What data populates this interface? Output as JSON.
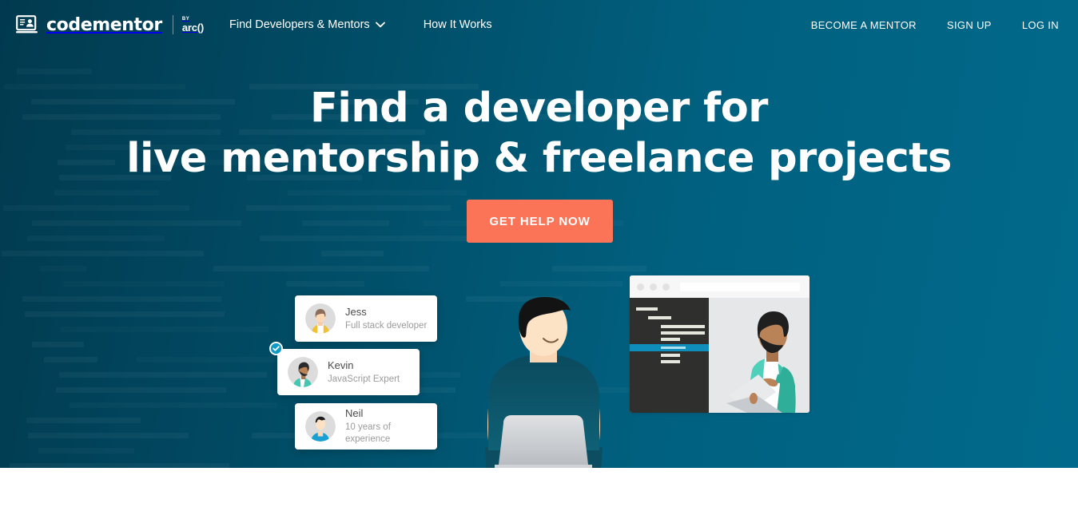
{
  "brand": {
    "name": "codementor",
    "by_label": "BY",
    "sub_name": "arc()",
    "logo_icon": "laptop-profile-icon",
    "accent_color": "#fc7458",
    "hero_gradient_from": "#013a4f",
    "hero_gradient_to": "#016a8c"
  },
  "nav": {
    "left_items": [
      {
        "label": "Find Developers & Mentors",
        "has_caret": true,
        "caret_icon": "chevron-down-icon"
      },
      {
        "label": "How It Works",
        "has_caret": false
      }
    ],
    "right_items": [
      {
        "label": "BECOME A MENTOR"
      },
      {
        "label": "SIGN UP"
      },
      {
        "label": "LOG IN"
      }
    ]
  },
  "hero": {
    "headline_line1": "Find a developer for",
    "headline_line2": "live mentorship & freelance projects",
    "cta_label": "GET HELP NOW"
  },
  "mentor_cards": [
    {
      "name": "Jess",
      "role": "Full stack developer",
      "avatar_icon": "avatar-jess",
      "verified": false
    },
    {
      "name": "Kevin",
      "role": "JavaScript Expert",
      "avatar_icon": "avatar-kevin",
      "verified": true,
      "badge_icon": "verified-check-icon",
      "badge_color": "#0f9bc4"
    },
    {
      "name": "Neil",
      "role": "10 years of experience",
      "avatar_icon": "avatar-neil",
      "verified": false
    }
  ],
  "illustration": {
    "person_icon": "person-with-laptop-icon",
    "browser_mock": {
      "window_dots": 3,
      "url_bar_icon": "url-bar",
      "code_panel_icon": "code-editor-panel",
      "highlight_color": "#0f8dbb",
      "photo_icon": "mentor-standing-with-laptop-icon"
    },
    "props_icon": "coffee-cup-and-book-icon"
  }
}
